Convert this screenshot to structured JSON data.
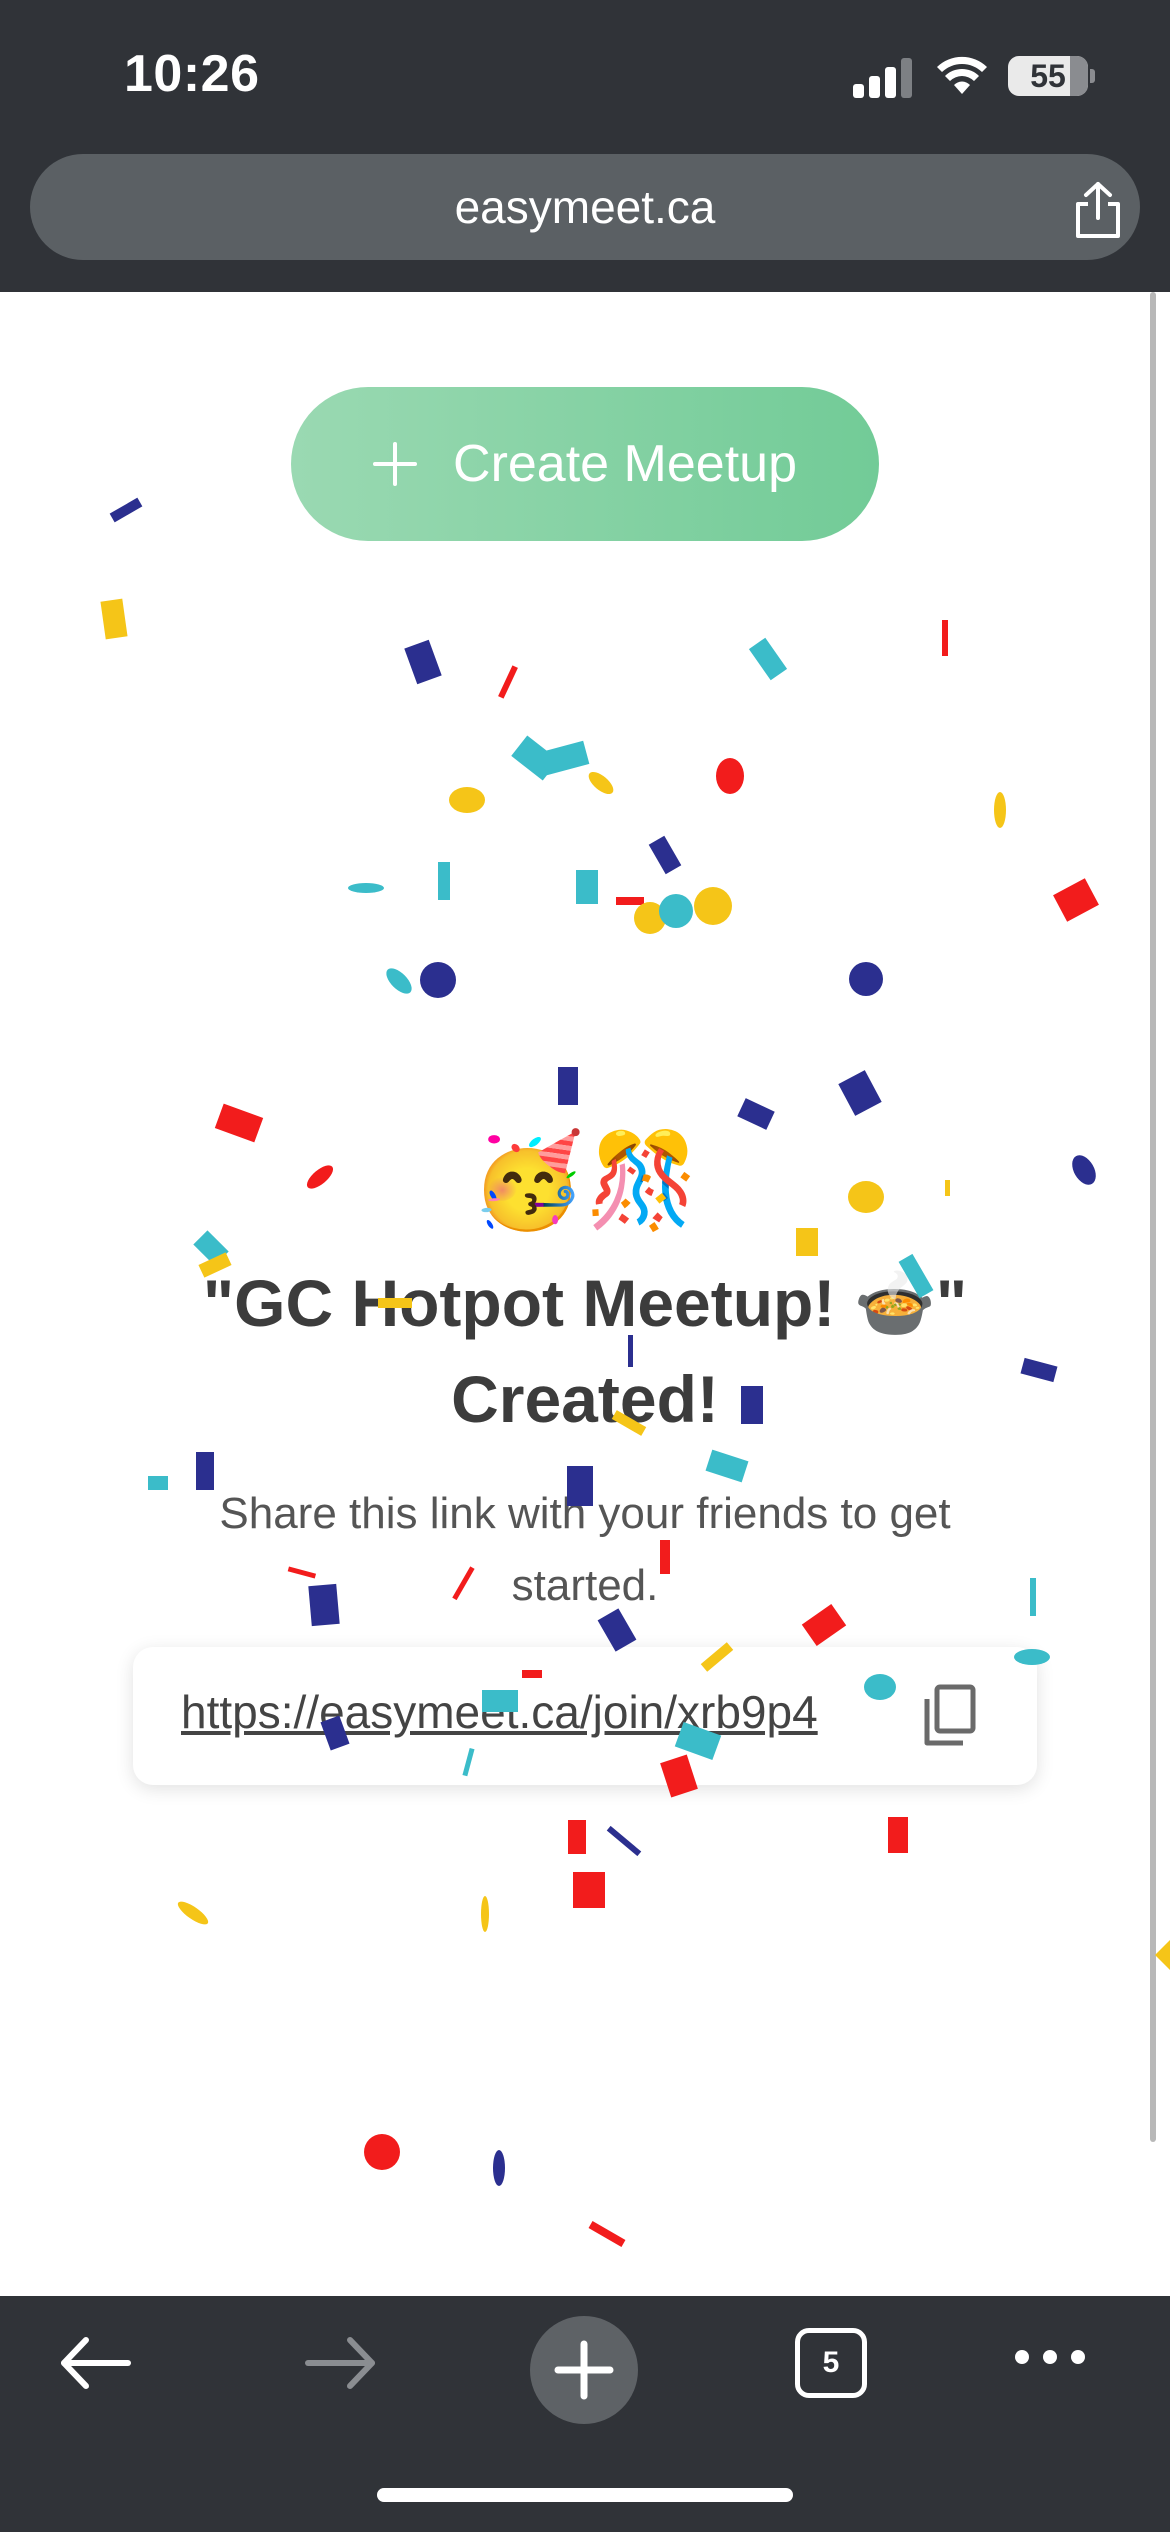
{
  "status_bar": {
    "time": "10:26",
    "battery_percent": "55"
  },
  "browser": {
    "url": "easymeet.ca",
    "tab_count": "5",
    "icons": [
      "share-icon",
      "back-arrow-icon",
      "forward-arrow-icon",
      "plus-icon",
      "tabs-icon",
      "more-icon"
    ]
  },
  "page": {
    "create_button_label": "Create Meetup",
    "emoji": "🥳🎊",
    "title_line1": "\"GC Hotpot Meetup! 🍲\"",
    "title_line2": "Created!",
    "subtitle": "Share this link with your friends to get started.",
    "share_link": "https://easymeet.ca/join/xrb9p4"
  },
  "colors": {
    "chrome": "#303338",
    "url_pill": "#5b6064",
    "button_start": "#9ad9b2",
    "button_end": "#72cb97",
    "confetti": [
      "#2b2f8f",
      "#f5c518",
      "#3bbcc9",
      "#f21c1c"
    ]
  }
}
